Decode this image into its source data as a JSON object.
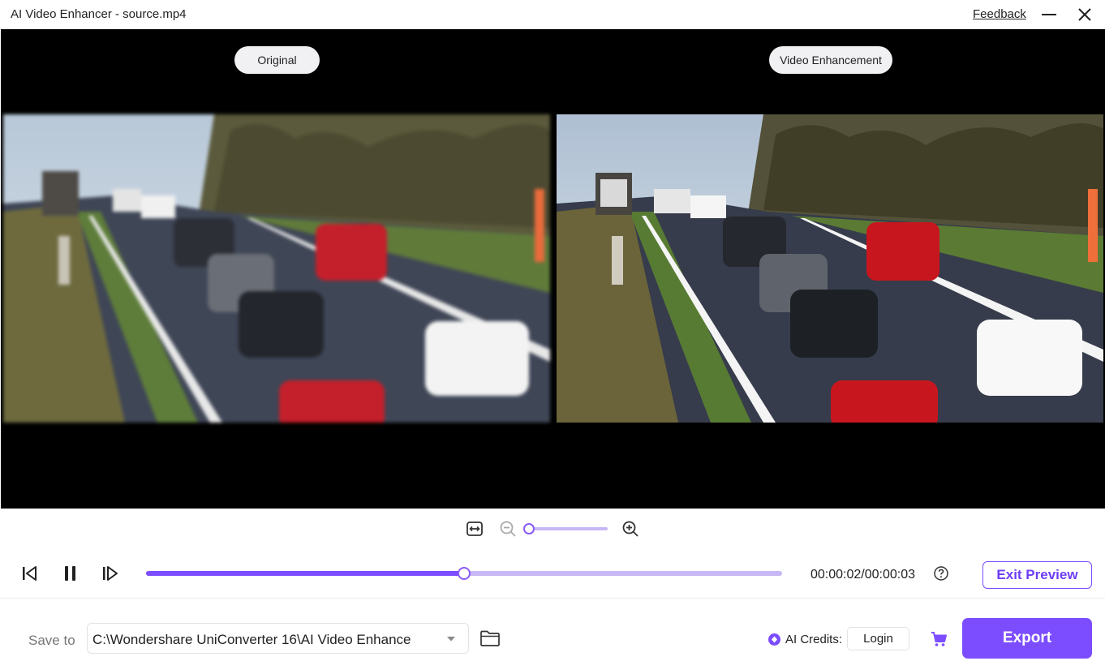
{
  "window": {
    "title": "AI Video Enhancer - source.mp4",
    "feedback_label": "Feedback",
    "icons": {
      "minimize": "minimize-icon",
      "close": "close-icon"
    }
  },
  "preview": {
    "left_label": "Original",
    "right_label": "Video Enhancement"
  },
  "zoom": {
    "icons": [
      "fit-width-icon",
      "zoom-out-icon",
      "zoom-in-icon"
    ],
    "level": 0.0
  },
  "playback": {
    "icons": [
      "previous-frame-icon",
      "pause-icon",
      "next-frame-icon",
      "help-icon"
    ],
    "progress": 0.5,
    "time": "00:00:02/00:00:03",
    "exit_preview_label": "Exit Preview"
  },
  "bottom": {
    "save_to_label": "Save to",
    "save_path": "C:\\Wondershare UniConverter 16\\AI Video Enhance",
    "ai_credits_label": "AI Credits:",
    "login_label": "Login",
    "export_label": "Export"
  },
  "colors": {
    "accent": "#7c4dff",
    "accent_light": "#c7b7f6",
    "preview_bg": "#000000"
  }
}
